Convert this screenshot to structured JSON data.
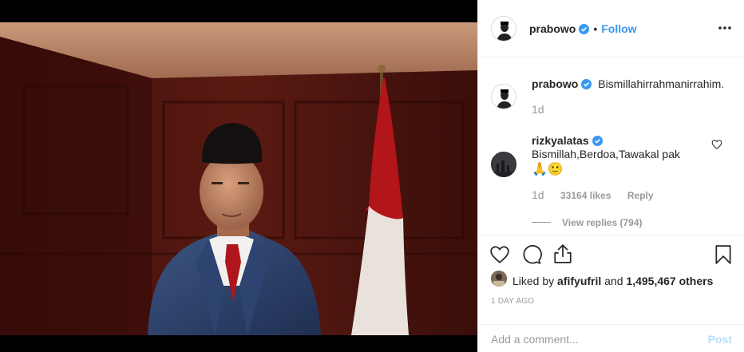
{
  "post": {
    "author": "prabowo",
    "follow_label": "Follow",
    "separator": "•",
    "caption": "Bismillahirrahmanirrahim.",
    "caption_time": "1d",
    "likes_text_prefix": "Liked by",
    "liked_by_user": "afifyufril",
    "likes_text_and": "and",
    "likes_count": "1,495,467 others",
    "date": "1 DAY AGO"
  },
  "comment": {
    "author": "rizkyalatas",
    "text": "Bismillah,Berdoa,Tawakal pak",
    "emoji": "🙏🙂",
    "time": "1d",
    "likes": "33164 likes",
    "reply_label": "Reply",
    "view_replies": "View replies (794)"
  },
  "composer": {
    "placeholder": "Add a comment...",
    "post_label": "Post"
  },
  "colors": {
    "accent": "#3897f0",
    "text": "#262626",
    "muted": "#999999",
    "post_disabled": "#b2dffc"
  },
  "icons": {
    "verified": "verified-badge-icon",
    "more": "more-options-icon",
    "like": "heart-icon",
    "comment": "comment-bubble-icon",
    "share": "share-icon",
    "save": "bookmark-icon",
    "comment_like": "small-heart-icon"
  }
}
